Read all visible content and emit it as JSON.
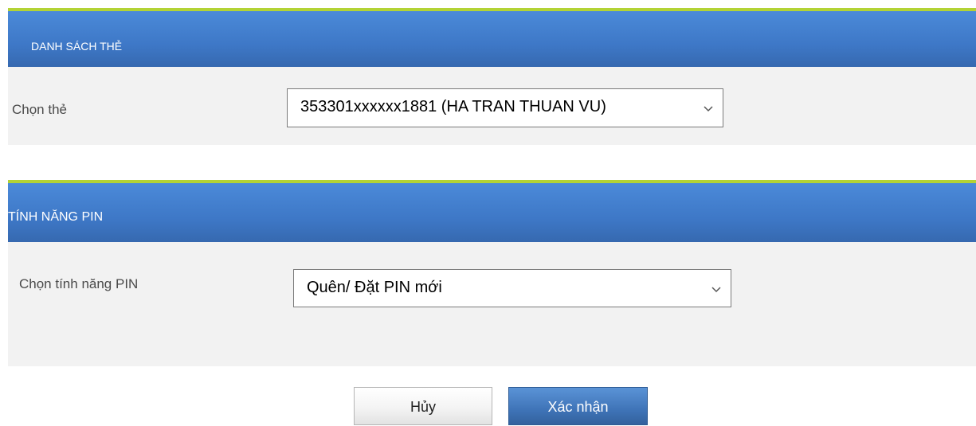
{
  "card_list": {
    "title": "DANH SÁCH THẺ",
    "select_label": "Chọn thẻ",
    "selected_card": "353301xxxxxx1881 (HA TRAN THUAN VU)"
  },
  "pin_feature": {
    "title": "TÍNH NĂNG PIN",
    "select_label": "Chọn tính năng PIN",
    "selected_option": "Quên/ Đặt PIN mới"
  },
  "actions": {
    "cancel_label": "Hủy",
    "confirm_label": "Xác nhận"
  },
  "colors": {
    "header_accent": "#b3d335",
    "header_blue": "#3e78c7",
    "body_gray": "#f2f2f2"
  },
  "icons": {
    "select_chevron": "chevron-down-icon"
  }
}
